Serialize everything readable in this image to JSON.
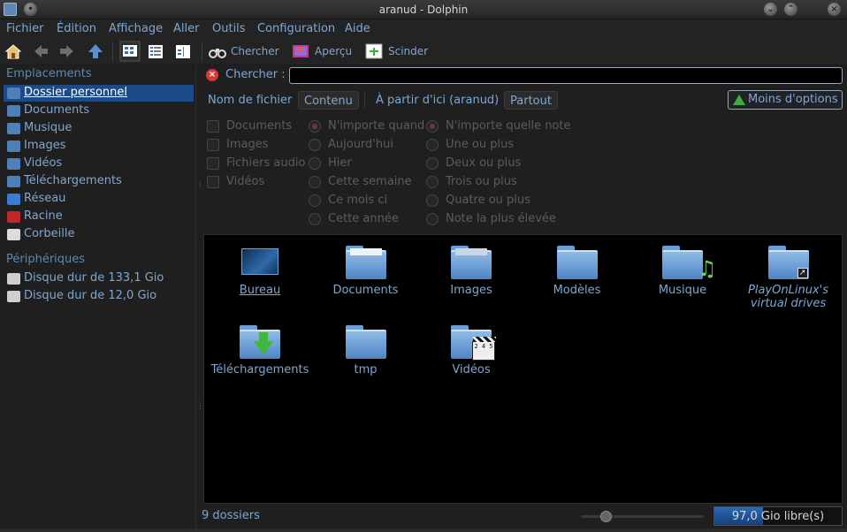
{
  "window": {
    "title": "aranud - Dolphin",
    "menu_icon": "window-menu-icon",
    "min_icon": "minimize-icon",
    "max_icon": "maximize-icon",
    "close_icon": "close-icon"
  },
  "menubar": [
    "Fichier",
    "Édition",
    "Affichage",
    "Aller",
    "Outils",
    "Configuration",
    "Aide"
  ],
  "toolbar": {
    "search_label": "Chercher",
    "preview_label": "Aperçu",
    "split_label": "Scinder"
  },
  "sidebar": {
    "places_header": "Emplacements",
    "places": [
      {
        "label": "Dossier personnel",
        "icon": "home-folder-icon",
        "color": "#4f7fb8",
        "selected": true
      },
      {
        "label": "Documents",
        "icon": "documents-folder-icon",
        "color": "#4f7fb8"
      },
      {
        "label": "Musique",
        "icon": "music-folder-icon",
        "color": "#4f7fb8"
      },
      {
        "label": "Images",
        "icon": "images-folder-icon",
        "color": "#4f7fb8"
      },
      {
        "label": "Vidéos",
        "icon": "videos-folder-icon",
        "color": "#4f7fb8"
      },
      {
        "label": "Téléchargements",
        "icon": "downloads-folder-icon",
        "color": "#4f7fb8"
      },
      {
        "label": "Réseau",
        "icon": "network-icon",
        "color": "#3b7bd0"
      },
      {
        "label": "Racine",
        "icon": "root-folder-icon",
        "color": "#c0262a"
      },
      {
        "label": "Corbeille",
        "icon": "trash-icon",
        "color": "#dcdcdc"
      }
    ],
    "devices_header": "Périphériques",
    "devices": [
      {
        "label": "Disque dur de 133,1 Gio",
        "icon": "hard-disk-icon",
        "color": "#cfcfcf"
      },
      {
        "label": "Disque dur de 12,0 Gio",
        "icon": "hard-disk-icon",
        "color": "#cfcfcf"
      }
    ]
  },
  "search": {
    "label": "Chercher :",
    "value": ""
  },
  "filters": {
    "filename": "Nom de fichier",
    "content": "Contenu",
    "from_here": "À partir d'ici (aranud)",
    "everywhere": "Partout",
    "less_options": "Moins d'options"
  },
  "options": {
    "types": [
      "Documents",
      "Images",
      "Fichiers audio",
      "Vidéos"
    ],
    "dates": [
      "N'importe quand",
      "Aujourd'hui",
      "Hier",
      "Cette semaine",
      "Ce mois ci",
      "Cette année"
    ],
    "ratings": [
      "N'importe quelle note",
      "Une ou plus",
      "Deux ou plus",
      "Trois ou plus",
      "Quatre ou plus",
      "Note la plus élevée"
    ]
  },
  "files": [
    {
      "name": "Bureau",
      "kind": "desktop"
    },
    {
      "name": "Documents",
      "kind": "documents"
    },
    {
      "name": "Images",
      "kind": "images"
    },
    {
      "name": "Modèles",
      "kind": "plain"
    },
    {
      "name": "Musique",
      "kind": "music"
    },
    {
      "name": "PlayOnLinux's virtual drives",
      "kind": "link"
    },
    {
      "name": "Téléchargements",
      "kind": "downloads"
    },
    {
      "name": "tmp",
      "kind": "plain"
    },
    {
      "name": "Vidéos",
      "kind": "videos"
    }
  ],
  "status": {
    "count": "9 dossiers",
    "free_space": "97,0 Gio libre(s)",
    "used_fraction": 0.38,
    "zoom_fraction": 0.2
  },
  "colors": {
    "accent": "#7ea7d3",
    "selection": "#1c4a86",
    "background": "#1f1f1f"
  }
}
